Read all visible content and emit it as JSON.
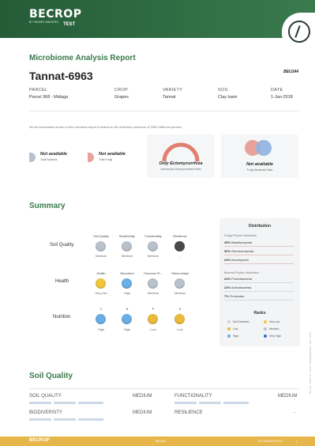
{
  "header": {
    "brand": "BECROP",
    "brand_sub": "BY BIOME MAKERS",
    "brand_test": "TEST"
  },
  "report": {
    "title": "Microbiome Analysis Report",
    "sample": "Tannat-6963",
    "code": "BEU144"
  },
  "meta": [
    {
      "k": "PARCEL",
      "v": "Parcel 368 - Málaga"
    },
    {
      "k": "CROP",
      "v": "Grapes"
    },
    {
      "k": "VARIETY",
      "v": "Tannat"
    },
    {
      "k": "SOIL",
      "v": "Clay loam"
    },
    {
      "k": "DATE",
      "v": "1-Jan-2018"
    }
  ],
  "note": "All the information shown in this microbial report is based on the detection presence of 3359 different species",
  "metrics": [
    {
      "b": "Not available",
      "s": "Total Bacteria"
    },
    {
      "b": "Not available",
      "s": "Total Fungi"
    },
    {
      "b": "Only Ectomycorrhiza",
      "s": "Arbuscular-Ectomycorrhiza Ratio"
    },
    {
      "b": "Not available",
      "s": "Fungi-Bacterial Ratio"
    }
  ],
  "summary": {
    "title": "Summary",
    "rows": [
      {
        "label": "Soil Quality",
        "cols": [
          "Soil Quality",
          "Biodiversity",
          "Functionality",
          "Resilience"
        ],
        "vals": [
          "Medium",
          "Medium",
          "Medium",
          "-"
        ],
        "colors": [
          "#b9c2cc",
          "#b9c2cc",
          "#b9c2cc",
          "#4a4a4a"
        ]
      },
      {
        "label": "Health",
        "cols": [
          "Health",
          "Biocontrol",
          "Hormone Pr...",
          "Stress Adapt"
        ],
        "vals": [
          "Very low",
          "High",
          "Medium",
          "Medium"
        ],
        "colors": [
          "#f0c73b",
          "#6aaee6",
          "#b9c2cc",
          "#b9c2cc"
        ]
      },
      {
        "label": "Nutrition",
        "cols": [
          "C",
          "N",
          "P",
          "K"
        ],
        "vals": [
          "High",
          "High",
          "Low",
          "Low"
        ],
        "colors": [
          "#6aaee6",
          "#6aaee6",
          "#e8bb3c",
          "#e8bb3c"
        ]
      }
    ]
  },
  "distribution": {
    "title": "Distribution",
    "fungal_title": "Fungal Phylum distribution",
    "fungal": [
      {
        "p": "45%",
        "n": "Basidiomycota"
      },
      {
        "p": "30%",
        "n": "Glomeromycota"
      },
      {
        "p": "24%",
        "n": "Ascomycota"
      }
    ],
    "bacterial_title": "Bacterial Phylum distribution",
    "bacterial": [
      {
        "p": "24%",
        "n": "Proteobacteria"
      },
      {
        "p": "22%",
        "n": "Actinobacteria"
      },
      {
        "p": "7%",
        "n": "Firmicutes"
      }
    ],
    "ranks_title": "Ranks",
    "ranks": [
      {
        "n": "Not Detected",
        "c": "#cfd4d9"
      },
      {
        "n": "Very low",
        "c": "#f0c73b"
      },
      {
        "n": "Low",
        "c": "#e8bb3c"
      },
      {
        "n": "Medium",
        "c": "#b9c2cc"
      },
      {
        "n": "High",
        "c": "#6aaee6"
      },
      {
        "n": "Very High",
        "c": "#2f6fd1"
      }
    ]
  },
  "soil_quality": {
    "title": "Soil Quality",
    "rows": [
      {
        "l1": "SOIL QUALITY",
        "v1": "MEDIUM",
        "l2": "FUNCTIONALITY",
        "v2": "MEDIUM"
      },
      {
        "l1": "BIODIVERSITY",
        "v1": "MEDIUM",
        "l2": "RESILIENCE",
        "v2": "-"
      }
    ]
  },
  "footer": {
    "brand": "BECROP",
    "mid": "BEU144",
    "right": "BIOMEMAKERS",
    "page": "1"
  },
  "side_text": "BE 130 · 5000 · 01 · 2018 · BIOMEMAKERS · REF · 0144"
}
